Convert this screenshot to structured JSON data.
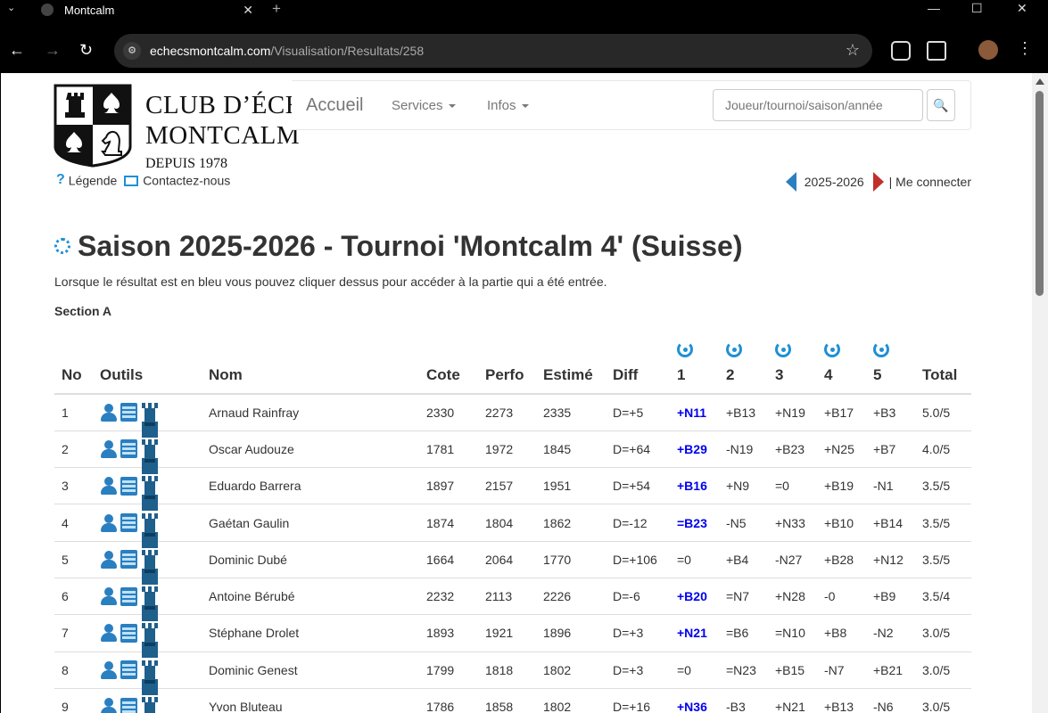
{
  "browser": {
    "tab_title": "Montcalm",
    "url_host": "echecsmontcalm.com",
    "url_path": "/Visualisation/Resultats/258"
  },
  "logo": {
    "line1": "CLUB D’ÉCHECS",
    "line2": "MONTCALM",
    "line3": "DEPUIS 1978"
  },
  "nav": {
    "brand": "Accueil",
    "services": "Services",
    "infos": "Infos",
    "search_placeholder": "Joueur/tournoi/saison/année",
    "search_icon": "magnifier-icon"
  },
  "links": {
    "legend": "Légende",
    "contact": "Contactez-nous",
    "season": "2025-2026",
    "login": "| Me connecter"
  },
  "page": {
    "title": "Saison 2025-2026 - Tournoi 'Montcalm 4' (Suisse)",
    "info": "Lorsque le résultat est en bleu vous pouvez cliquer dessus pour accéder à la partie qui a été entrée.",
    "section": "Section A"
  },
  "table": {
    "headers": [
      "No",
      "Outils",
      "Nom",
      "Cote",
      "Perfo",
      "Estimé",
      "Diff",
      "1",
      "2",
      "3",
      "4",
      "5",
      "Total"
    ],
    "rows": [
      {
        "no": "1",
        "nom": "Arnaud Rainfray",
        "cote": "2330",
        "perfo": "2273",
        "estime": "2335",
        "diff": "D=+5",
        "r1": "+N11",
        "r2": "+B13",
        "r3": "+N19",
        "r4": "+B17",
        "r5": "+B3",
        "total": "5.0/5"
      },
      {
        "no": "2",
        "nom": "Oscar Audouze",
        "cote": "1781",
        "perfo": "1972",
        "estime": "1845",
        "diff": "D=+64",
        "r1": "+B29",
        "r2": "-N19",
        "r3": "+B23",
        "r4": "+N25",
        "r5": "+B7",
        "total": "4.0/5"
      },
      {
        "no": "3",
        "nom": "Eduardo Barrera",
        "cote": "1897",
        "perfo": "2157",
        "estime": "1951",
        "diff": "D=+54",
        "r1": "+B16",
        "r2": "+N9",
        "r3": "=0",
        "r4": "+B19",
        "r5": "-N1",
        "total": "3.5/5"
      },
      {
        "no": "4",
        "nom": "Gaétan Gaulin",
        "cote": "1874",
        "perfo": "1804",
        "estime": "1862",
        "diff": "D=-12",
        "r1": "=B23",
        "r2": "-N5",
        "r3": "+N33",
        "r4": "+B10",
        "r5": "+B14",
        "total": "3.5/5"
      },
      {
        "no": "5",
        "nom": "Dominic Dubé",
        "cote": "1664",
        "perfo": "2064",
        "estime": "1770",
        "diff": "D=+106",
        "r1": "=0",
        "r2": "+B4",
        "r3": "-N27",
        "r4": "+B28",
        "r5": "+N12",
        "total": "3.5/5"
      },
      {
        "no": "6",
        "nom": "Antoine Bérubé",
        "cote": "2232",
        "perfo": "2113",
        "estime": "2226",
        "diff": "D=-6",
        "r1": "+B20",
        "r2": "=N7",
        "r3": "+N28",
        "r4": "-0",
        "r5": "+B9",
        "total": "3.5/4"
      },
      {
        "no": "7",
        "nom": "Stéphane Drolet",
        "cote": "1893",
        "perfo": "1921",
        "estime": "1896",
        "diff": "D=+3",
        "r1": "+N21",
        "r2": "=B6",
        "r3": "=N10",
        "r4": "+B8",
        "r5": "-N2",
        "total": "3.0/5"
      },
      {
        "no": "8",
        "nom": "Dominic Genest",
        "cote": "1799",
        "perfo": "1818",
        "estime": "1802",
        "diff": "D=+3",
        "r1": "=0",
        "r2": "=N23",
        "r3": "+B15",
        "r4": "-N7",
        "r5": "+B21",
        "total": "3.0/5"
      },
      {
        "no": "9",
        "nom": "Yvon Bluteau",
        "cote": "1786",
        "perfo": "1858",
        "estime": "1802",
        "diff": "D=+16",
        "r1": "+N36",
        "r2": "-B3",
        "r3": "+N21",
        "r4": "+B13",
        "r5": "-N6",
        "total": "3.0/5"
      }
    ],
    "linked_r1": [
      true,
      true,
      true,
      true,
      false,
      true,
      true,
      false,
      true
    ]
  },
  "colors": {
    "link_result": "#0000ee",
    "accent": "#1e90d6"
  }
}
